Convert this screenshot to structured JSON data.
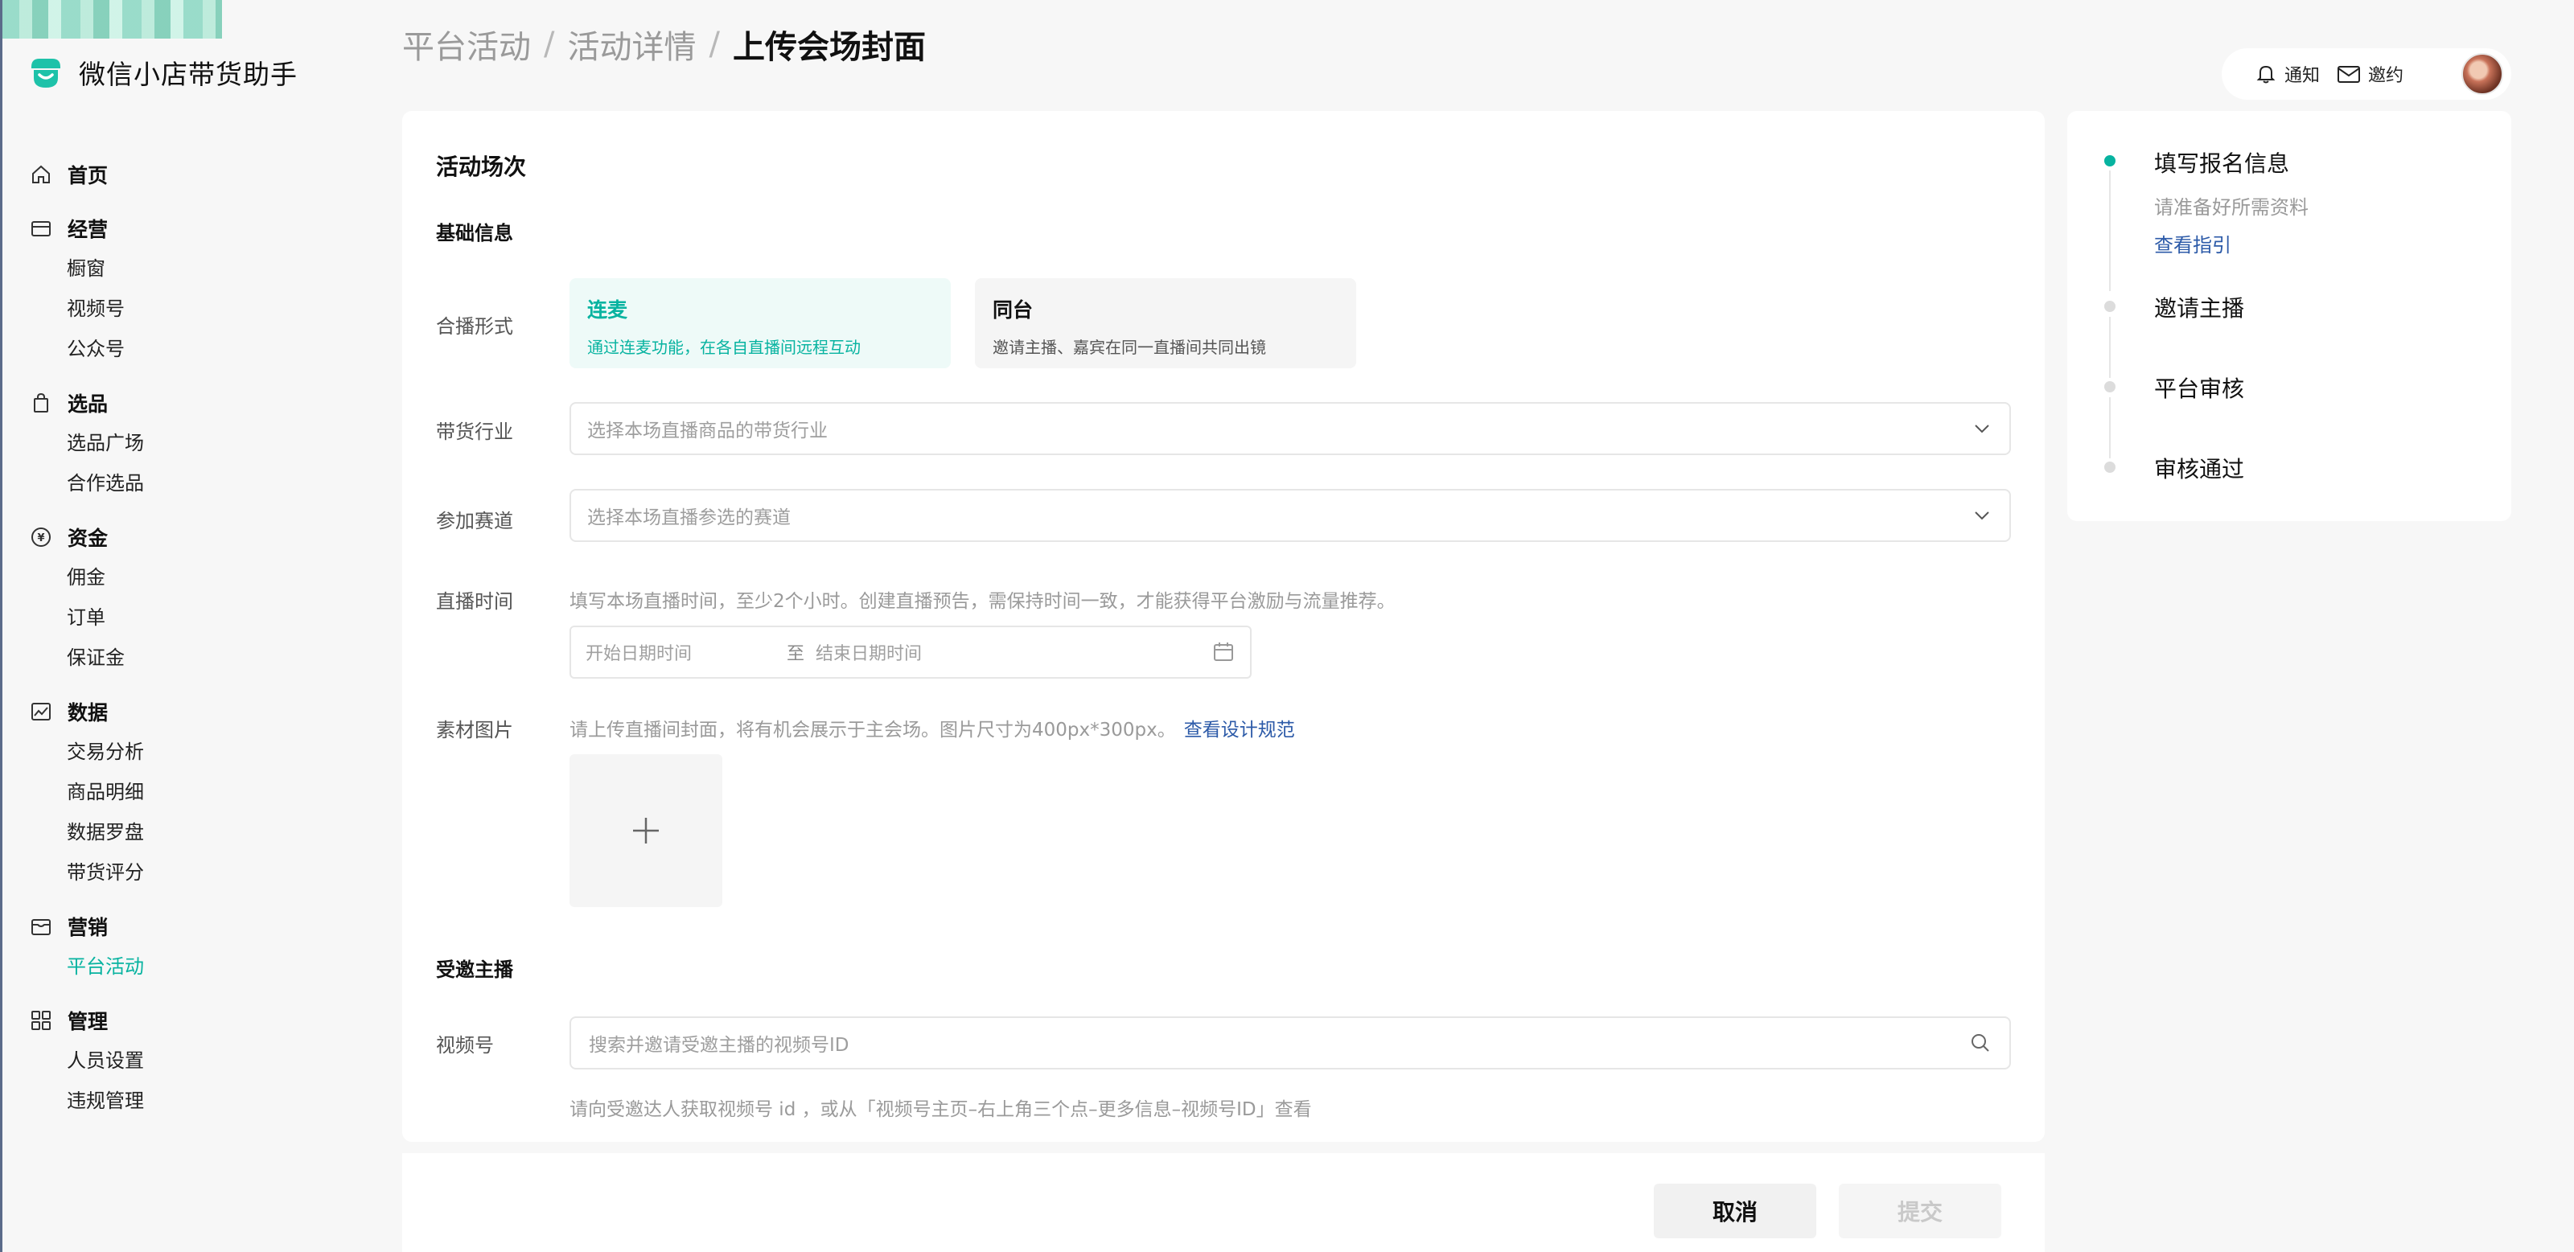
{
  "brand": {
    "name": "微信小店带货助手"
  },
  "sidebar": {
    "groups": [
      {
        "title": "首页",
        "icon": "home-icon",
        "items": []
      },
      {
        "title": "经营",
        "icon": "store-icon",
        "items": [
          "橱窗",
          "视频号",
          "公众号"
        ]
      },
      {
        "title": "选品",
        "icon": "shopping-bag-icon",
        "items": [
          "选品广场",
          "合作选品"
        ]
      },
      {
        "title": "资金",
        "icon": "yen-coin-icon",
        "items": [
          "佣金",
          "订单",
          "保证金"
        ]
      },
      {
        "title": "数据",
        "icon": "chart-icon",
        "items": [
          "交易分析",
          "商品明细",
          "数据罗盘",
          "带货评分"
        ]
      },
      {
        "title": "营销",
        "icon": "gift-box-icon",
        "items": [
          "平台活动"
        ]
      },
      {
        "title": "管理",
        "icon": "grid-icon",
        "items": [
          "人员设置",
          "违规管理"
        ]
      }
    ],
    "active_item": "平台活动"
  },
  "breadcrumb": {
    "level1": "平台活动",
    "level2": "活动详情",
    "current": "上传会场封面",
    "separator": "/"
  },
  "topbar": {
    "notify_label": "通知",
    "invite_label": "邀约"
  },
  "form": {
    "title": "活动场次",
    "basic_section": "基础信息",
    "broadcast_mode": {
      "label": "合播形式",
      "options": [
        {
          "title": "连麦",
          "desc": "通过连麦功能，在各自直播间远程互动",
          "selected": true
        },
        {
          "title": "同台",
          "desc": "邀请主播、嘉宾在同一直播间共同出镜",
          "selected": false
        }
      ]
    },
    "industry": {
      "label": "带货行业",
      "placeholder": "选择本场直播商品的带货行业"
    },
    "track": {
      "label": "参加赛道",
      "placeholder": "选择本场直播参选的赛道"
    },
    "live_time": {
      "label": "直播时间",
      "hint": "填写本场直播时间，至少2个小时。创建直播预告，需保持时间一致，才能获得平台激励与流量推荐。",
      "start_placeholder": "开始日期时间",
      "to": "至",
      "end_placeholder": "结束日期时间"
    },
    "material": {
      "label": "素材图片",
      "hint": "请上传直播间封面，将有机会展示于主会场。图片尺寸为400px*300px。",
      "link": "查看设计规范"
    },
    "invited_section": "受邀主播",
    "channel_id": {
      "label": "视频号",
      "placeholder": "搜索并邀请受邀主播的视频号ID",
      "hint": "请向受邀达人获取视频号 id ，或从「视频号主页–右上角三个点–更多信息–视频号ID」查看"
    }
  },
  "actions": {
    "cancel": "取消",
    "submit": "提交"
  },
  "steps": [
    {
      "title": "填写报名信息",
      "sub": "请准备好所需资料",
      "link": "查看指引",
      "active": true
    },
    {
      "title": "邀请主播",
      "active": false
    },
    {
      "title": "平台审核",
      "active": false
    },
    {
      "title": "审核通过",
      "active": false
    }
  ],
  "colors": {
    "accent": "#07b3a0",
    "link": "#2c5aa8"
  }
}
